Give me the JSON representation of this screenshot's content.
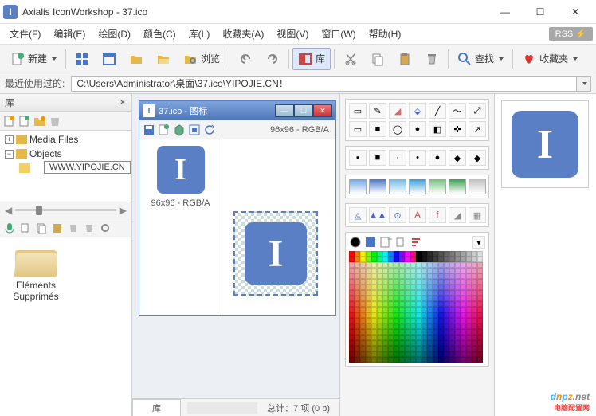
{
  "window": {
    "title": "Axialis IconWorkshop - 37.ico",
    "app_icon_letter": "I"
  },
  "menu": {
    "items": [
      "文件(F)",
      "编辑(E)",
      "绘图(D)",
      "颜色(C)",
      "库(L)",
      "收藏夹(A)",
      "视图(V)",
      "窗口(W)",
      "帮助(H)"
    ],
    "rss": "RSS ⚡"
  },
  "toolbar": {
    "new": "新建",
    "browse": "浏览",
    "lib": "库",
    "search": "查找",
    "favorites": "收藏夹"
  },
  "pathbar": {
    "label": "最近使用过的:",
    "path": "C:\\Users\\Administrator\\桌面\\37.ico\\YIPOJIE.CN！"
  },
  "library": {
    "title": "库",
    "tree": {
      "media": "Media Files",
      "objects": "Objects",
      "tooltip": "WWW.YIPOJIE.CN"
    },
    "file": {
      "line1": "Eléments",
      "line2": "Supprimés"
    }
  },
  "doc": {
    "title": "37.ico - 图标",
    "meta": "96x96 - RGB/A",
    "icon_label": "96x96 - RGB/A",
    "tab": "库",
    "status": "总计：7 项 (0 b)"
  },
  "tool_swatches": [
    "#6fa5e0",
    "#4a76c8",
    "#6fb8e8",
    "#3a9dd8",
    "#72c080",
    "#3aa050",
    "#c0c0c0"
  ],
  "tool_letters": [
    "◬",
    "▲▲",
    "⊙",
    "A",
    "f",
    "◢",
    "▦"
  ]
}
